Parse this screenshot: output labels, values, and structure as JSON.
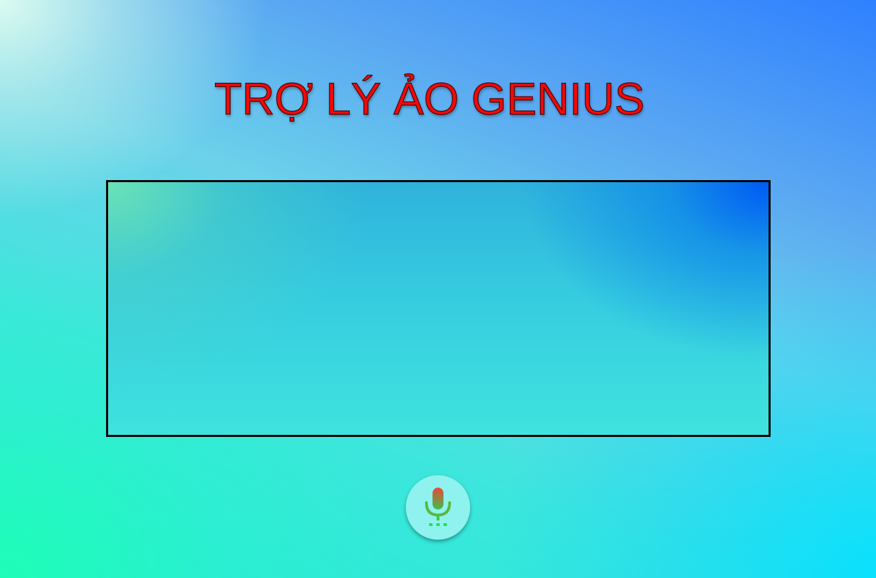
{
  "header": {
    "title": "TRỢ LÝ ẢO GENIUS"
  },
  "transcript_panel": {
    "text": ""
  },
  "mic_button": {
    "icon": "microphone-icon"
  },
  "colors": {
    "title": "#ee0a0a",
    "panel_border": "#000000",
    "mic_button_bg": "#8ff2ee",
    "mic_top": "#e84a3a",
    "mic_bottom": "#3fbf4a"
  }
}
